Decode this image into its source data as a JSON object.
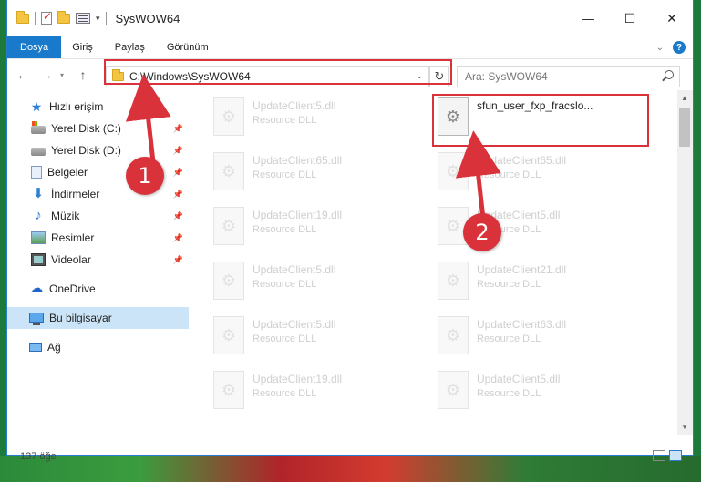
{
  "window": {
    "title": "SysWOW64",
    "controls": {
      "minimize": "—",
      "maximize": "☐",
      "close": "✕"
    }
  },
  "ribbon": {
    "tabs": [
      {
        "label": "Dosya",
        "active": true
      },
      {
        "label": "Giriş"
      },
      {
        "label": "Paylaş"
      },
      {
        "label": "Görünüm"
      }
    ],
    "help": "?"
  },
  "address": {
    "path": "C:\\Windows\\SysWOW64",
    "search_placeholder": "Ara: SysWOW64"
  },
  "nav": {
    "quick_access": "Hızlı erişim",
    "items": [
      {
        "label": "Yerel Disk (C:)",
        "icon": "disk-c-icon",
        "pinned": true
      },
      {
        "label": "Yerel Disk (D:)",
        "icon": "disk-d-icon",
        "pinned": true
      },
      {
        "label": "Belgeler",
        "icon": "documents-icon",
        "pinned": true
      },
      {
        "label": "İndirmeler",
        "icon": "downloads-icon",
        "pinned": true
      },
      {
        "label": "Müzik",
        "icon": "music-icon",
        "pinned": true
      },
      {
        "label": "Resimler",
        "icon": "pictures-icon",
        "pinned": true
      },
      {
        "label": "Videolar",
        "icon": "videos-icon",
        "pinned": true
      }
    ],
    "onedrive": "OneDrive",
    "this_pc": "Bu bilgisayar",
    "network": "Ağ"
  },
  "files": {
    "left_column": [
      {
        "name": "UpdateClient5.dll",
        "type": "Resource DLL"
      },
      {
        "name": "UpdateClient65.dll",
        "type": "Resource DLL"
      },
      {
        "name": "UpdateClient19.dll",
        "type": "Resource DLL"
      },
      {
        "name": "UpdateClient5.dll",
        "type": "Resource DLL"
      },
      {
        "name": "UpdateClient5.dll",
        "type": "Resource DLL"
      },
      {
        "name": "UpdateClient19.dll",
        "type": "Resource DLL"
      }
    ],
    "right_column": [
      {
        "name": "sfun_user_fxp_fracslo...",
        "type": ""
      },
      {
        "name": "UpdateClient65.dll",
        "type": "Resource DLL"
      },
      {
        "name": "UpdateClient5.dll",
        "type": "Resource DLL"
      },
      {
        "name": "UpdateClient21.dll",
        "type": "Resource DLL"
      },
      {
        "name": "UpdateClient63.dll",
        "type": "Resource DLL"
      },
      {
        "name": "UpdateClient5.dll",
        "type": "Resource DLL"
      }
    ]
  },
  "status": {
    "count": "137 öğe"
  },
  "annotations": {
    "step1": "1",
    "step2": "2",
    "color": "#d9323a"
  }
}
